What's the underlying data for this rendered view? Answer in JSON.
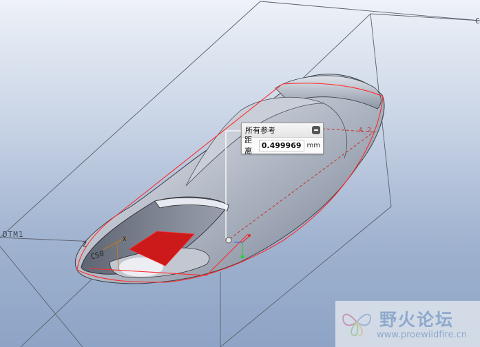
{
  "viewport": {
    "datum_plane_label": "DTM1",
    "corner_datum_label": "C",
    "axis_label_right": "A_2",
    "axis_label_z": "Z",
    "axis_label_x": "X",
    "coord_sys_label": "CS0",
    "face_highlight_color": "#cc1a1a",
    "edge_highlight_color": "#ff2a2a"
  },
  "reference_panel": {
    "title": "所有参考",
    "distance_label": "距离",
    "distance_value": "0.499969",
    "unit": "mm",
    "collapse_icon": "minus-icon"
  },
  "watermark": {
    "name_cn": "野火论坛",
    "url": "www.proewildfire.cn"
  }
}
